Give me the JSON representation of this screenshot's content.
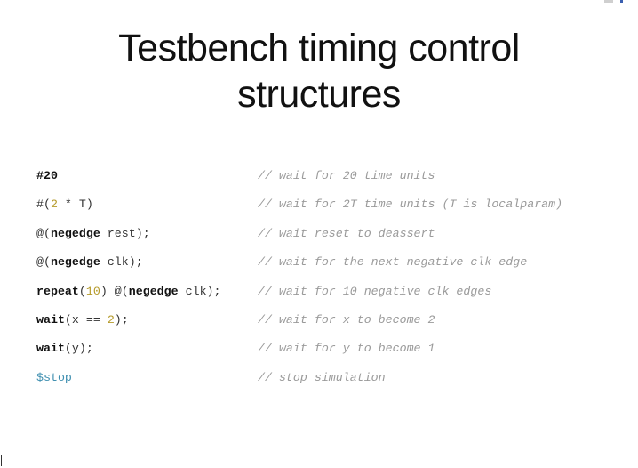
{
  "slide": {
    "title_line1": "Testbench timing control",
    "title_line2": "structures"
  },
  "code_lines": [
    {
      "parts": [
        {
          "t": "#20",
          "c": "kw"
        }
      ],
      "comment": "// wait for 20 time units"
    },
    {
      "parts": [
        {
          "t": "#(",
          "c": ""
        },
        {
          "t": "2",
          "c": "num"
        },
        {
          "t": " * T)",
          "c": ""
        }
      ],
      "comment": "// wait for 2T time units (T is localparam)"
    },
    {
      "parts": [
        {
          "t": "@(",
          "c": ""
        },
        {
          "t": "negedge",
          "c": "kw"
        },
        {
          "t": " rest);",
          "c": ""
        }
      ],
      "comment": "// wait reset to deassert"
    },
    {
      "parts": [
        {
          "t": "@(",
          "c": ""
        },
        {
          "t": "negedge",
          "c": "kw"
        },
        {
          "t": " clk);",
          "c": ""
        }
      ],
      "comment": "// wait for the next negative clk edge"
    },
    {
      "parts": [
        {
          "t": "repeat",
          "c": "kw"
        },
        {
          "t": "(",
          "c": ""
        },
        {
          "t": "10",
          "c": "num"
        },
        {
          "t": ") @(",
          "c": ""
        },
        {
          "t": "negedge",
          "c": "kw"
        },
        {
          "t": " clk);",
          "c": ""
        }
      ],
      "comment": "// wait for 10 negative clk edges"
    },
    {
      "parts": [
        {
          "t": "wait",
          "c": "kw"
        },
        {
          "t": "(x == ",
          "c": ""
        },
        {
          "t": "2",
          "c": "num"
        },
        {
          "t": ");",
          "c": ""
        }
      ],
      "comment": "// wait for x to become 2"
    },
    {
      "parts": [
        {
          "t": "wait",
          "c": "kw"
        },
        {
          "t": "(y);",
          "c": ""
        }
      ],
      "comment": "// wait for y to become 1"
    },
    {
      "parts": [
        {
          "t": "$stop",
          "c": "sys"
        }
      ],
      "comment": "// stop simulation"
    }
  ]
}
